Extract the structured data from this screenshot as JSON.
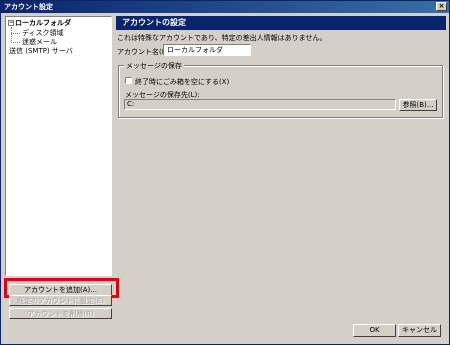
{
  "window": {
    "title": "アカウント設定",
    "close_glyph": "×"
  },
  "tree": {
    "expander": "−",
    "root": "ローカルフォルダ",
    "children": [
      "ディスク領域",
      "迷惑メール"
    ],
    "smtp": "送信 (SMTP) サーバ"
  },
  "buttons": {
    "add_account": "アカウントを追加(A)...",
    "set_default": "既定のアカウントに設定(E)",
    "delete_account": "アカウントを削除(R)",
    "ok": "OK",
    "cancel": "キャンセル",
    "browse": "参照(B)..."
  },
  "panel": {
    "header": "アカウントの設定",
    "description": "これは特殊なアカウントであり、特定の差出人情報はありません。",
    "account_name_label": "アカウント名(N):",
    "account_name_value": "ローカルフォルダ",
    "group_title": "メッセージの保存",
    "empty_trash_label": "終了時にごみ箱を空にする(X)",
    "empty_trash_checked": false,
    "store_path_label": "メッセージの保存先(L):",
    "store_path_value": "C:"
  },
  "colors": {
    "titlebar": "#0a246a",
    "header": "#0a246a",
    "highlight": "#e0000f",
    "face": "#d4d0c8"
  }
}
